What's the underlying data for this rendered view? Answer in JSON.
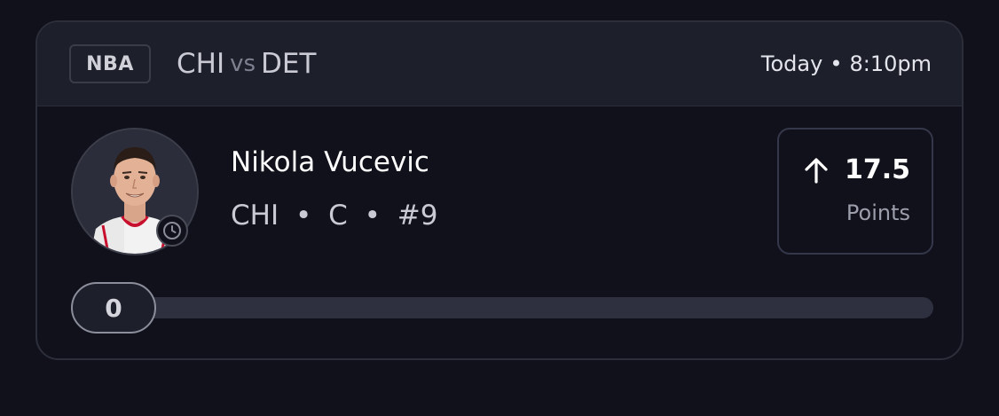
{
  "header": {
    "league": "NBA",
    "home_team": "CHI",
    "vs": "vs",
    "away_team": "DET",
    "day": "Today",
    "dot": "•",
    "time": "8:10pm"
  },
  "player": {
    "name": "Nikola Vucevic",
    "team": "CHI",
    "position": "C",
    "number": "#9",
    "separator": "•",
    "avatar_icon": "player-photo",
    "status_icon": "clock-icon"
  },
  "line": {
    "direction_icon": "arrow-up-icon",
    "value": "17.5",
    "stat": "Points"
  },
  "progress": {
    "current": "0",
    "fraction": 0
  },
  "colors": {
    "background": "#10111b",
    "header_bg": "#1d1f2b",
    "border": "#2c2e3a",
    "text_primary": "#ffffff",
    "text_secondary": "#9c9eab",
    "jersey_red": "#c8102e"
  }
}
